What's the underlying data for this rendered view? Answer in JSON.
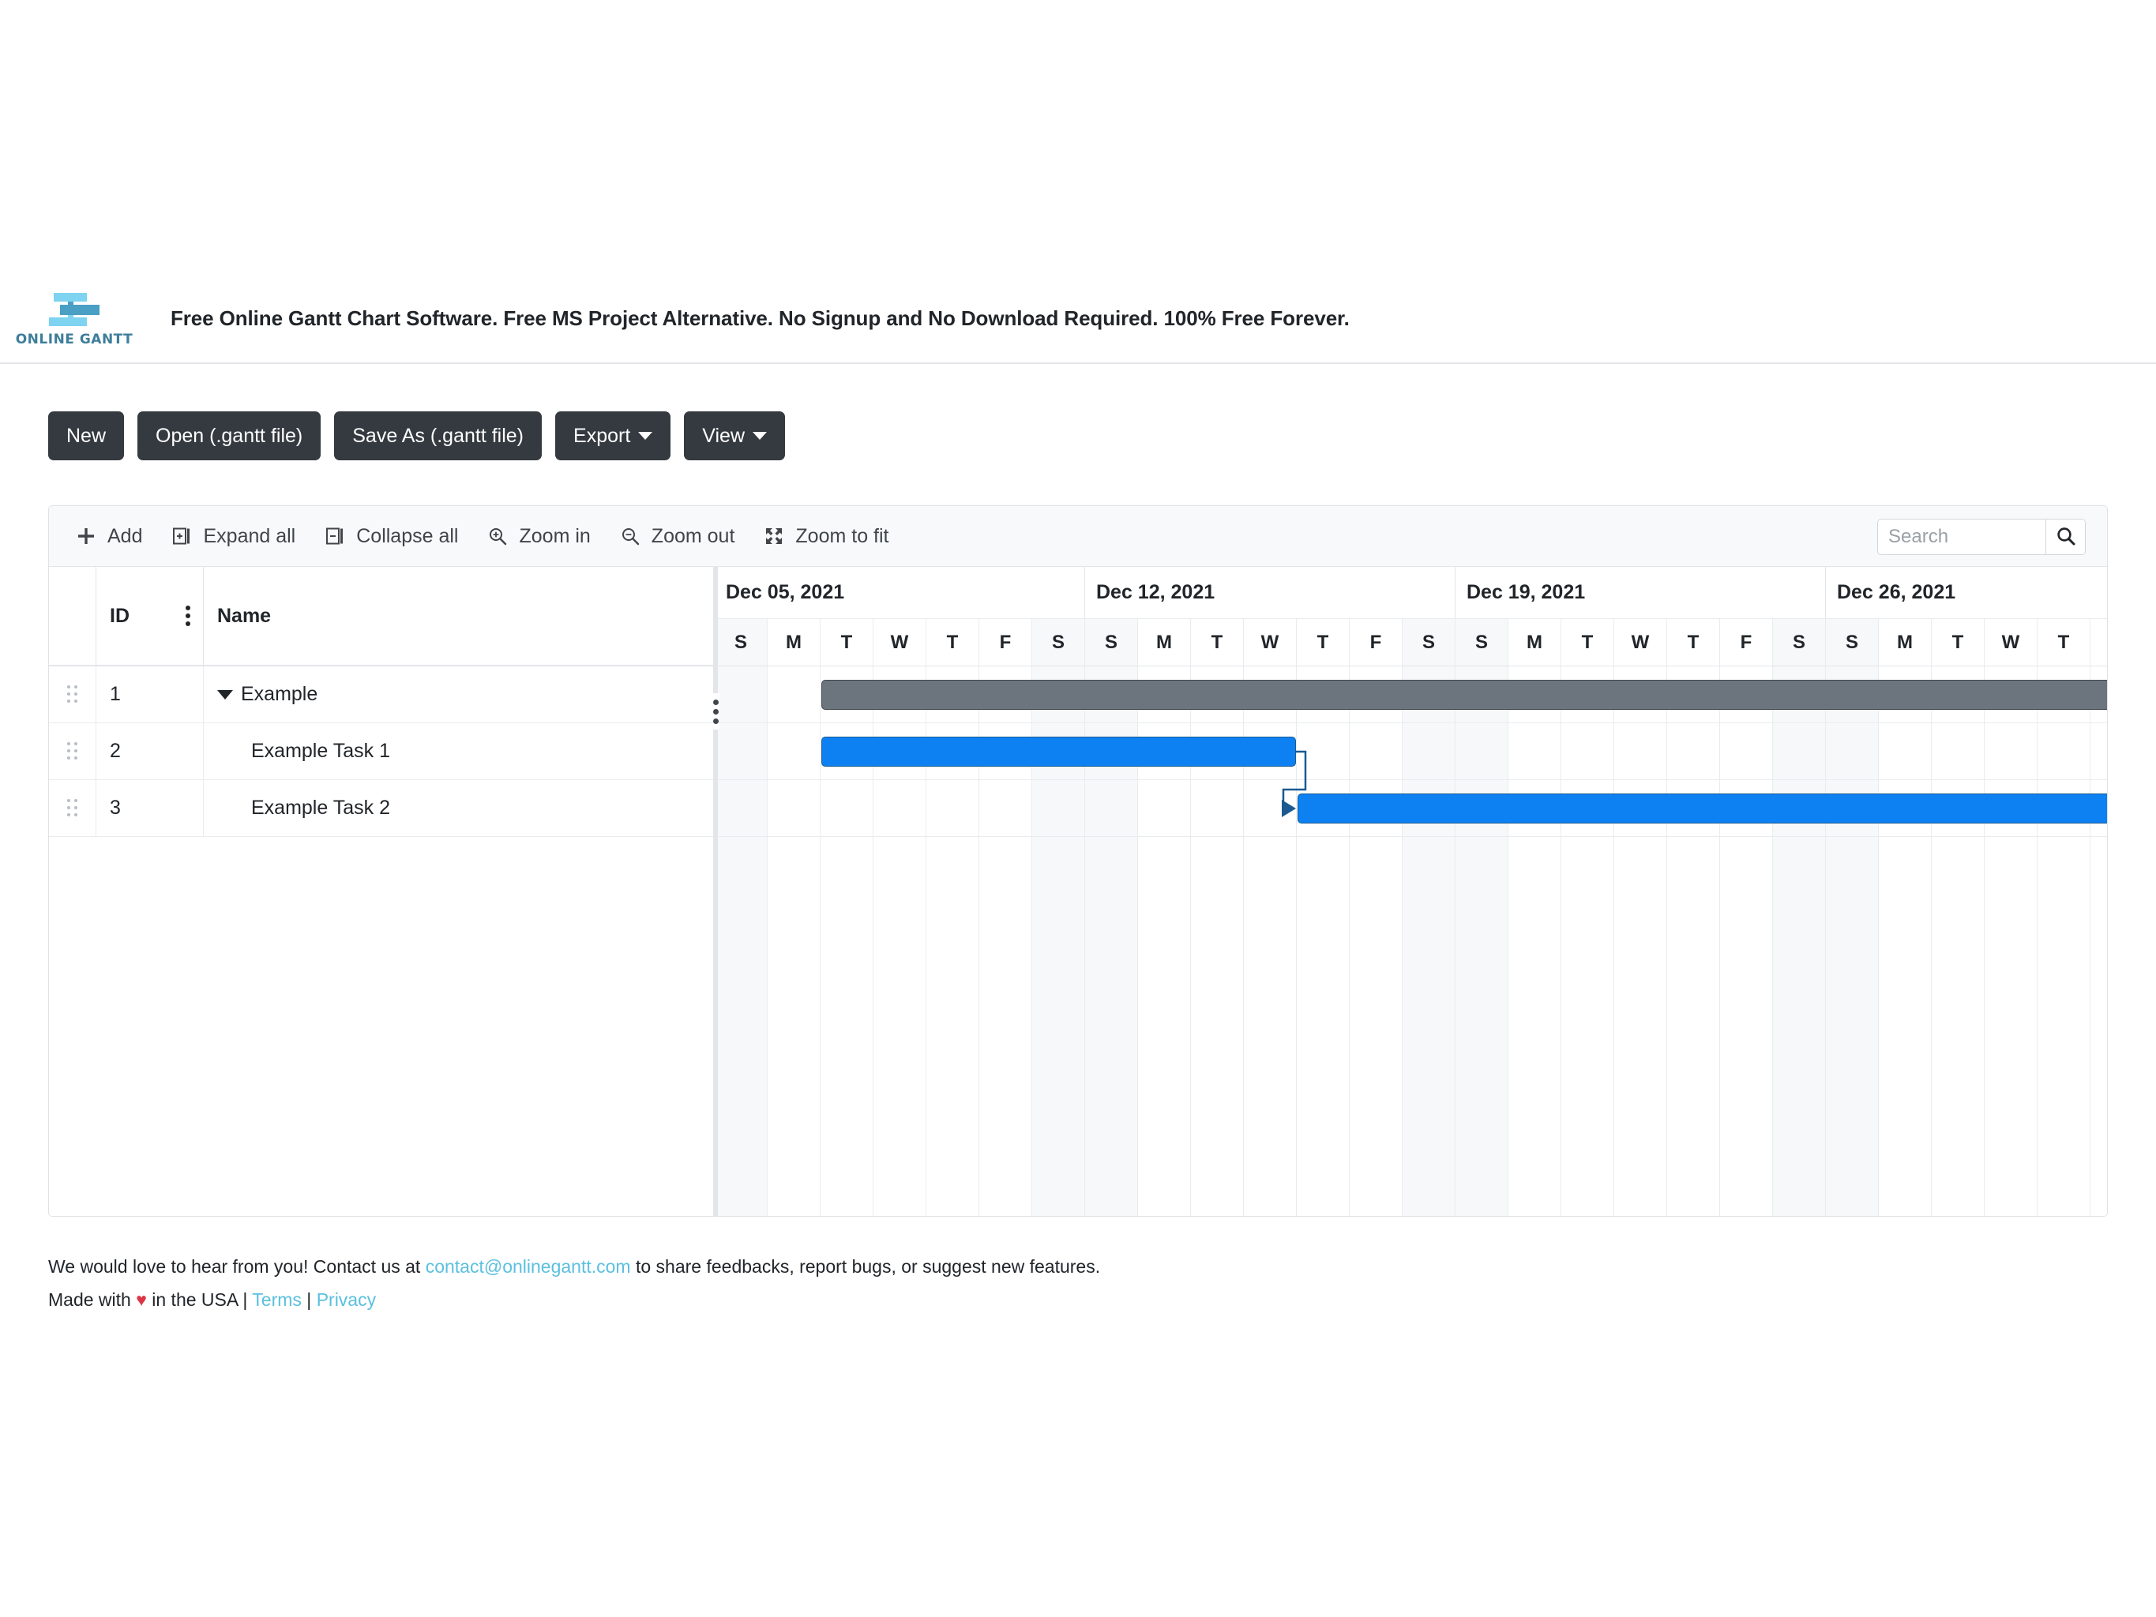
{
  "masthead": {
    "logo_word": "ONLINE GANTT",
    "logo_icon": "gantt-bars-logo",
    "tagline": "Free Online Gantt Chart Software. Free MS Project Alternative. No Signup and No Download Required. 100% Free Forever."
  },
  "file_toolbar": {
    "buttons": [
      {
        "label": "New",
        "caret": false
      },
      {
        "label": "Open (.gantt file)",
        "caret": false
      },
      {
        "label": "Save As (.gantt file)",
        "caret": false
      },
      {
        "label": "Export",
        "caret": true
      },
      {
        "label": "View",
        "caret": true
      }
    ]
  },
  "gantt_toolbar": {
    "actions": [
      {
        "label": "Add",
        "icon": "plus-icon"
      },
      {
        "label": "Expand all",
        "icon": "expand-all-icon"
      },
      {
        "label": "Collapse all",
        "icon": "collapse-all-icon"
      },
      {
        "label": "Zoom in",
        "icon": "zoom-in-icon"
      },
      {
        "label": "Zoom out",
        "icon": "zoom-out-icon"
      },
      {
        "label": "Zoom to fit",
        "icon": "zoom-to-fit-icon"
      }
    ],
    "search": {
      "placeholder": "Search",
      "value": "",
      "button_icon": "search-icon"
    }
  },
  "grid": {
    "columns": [
      {
        "key": "id",
        "label": "ID"
      },
      {
        "key": "name",
        "label": "Name"
      }
    ],
    "id_column_menu_icon": "kebab-menu-icon",
    "rows": [
      {
        "id": "1",
        "name": "Example",
        "type": "summary",
        "expanded": true,
        "indent": 0
      },
      {
        "id": "2",
        "name": "Example Task 1",
        "type": "task",
        "expanded": false,
        "indent": 1
      },
      {
        "id": "3",
        "name": "Example Task 2",
        "type": "task",
        "expanded": false,
        "indent": 1
      }
    ]
  },
  "chart_data": {
    "type": "bar",
    "title": "Gantt chart timeline",
    "weeks": [
      {
        "label": "Dec 05, 2021"
      },
      {
        "label": "Dec 12, 2021"
      },
      {
        "label": "Dec 19, 2021"
      },
      {
        "label": "Dec 26, 2021"
      }
    ],
    "day_labels": [
      "S",
      "M",
      "T",
      "W",
      "T",
      "F",
      "S"
    ],
    "weekend_indices": [
      0,
      6
    ],
    "day_column_width": 67,
    "total_days": 28,
    "bars": [
      {
        "row": 0,
        "task_id": "1",
        "name": "Example",
        "style": "summary",
        "color": "#6c757d",
        "border_color": "#41464b",
        "start_day_index": 2,
        "end_day_index": 27,
        "start_date": "Dec 07, 2021",
        "end_date": "Dec 31, 2021"
      },
      {
        "row": 1,
        "task_id": "2",
        "name": "Example Task 1",
        "style": "task",
        "color": "#0d80f2",
        "border_color": "#1a5a91",
        "start_day_index": 2,
        "end_day_index": 10,
        "start_date": "Dec 07, 2021",
        "end_date": "Dec 15, 2021"
      },
      {
        "row": 2,
        "task_id": "3",
        "name": "Example Task 2",
        "style": "task",
        "color": "#0d80f2",
        "border_color": "#1a5a91",
        "start_day_index": 11,
        "end_day_index": 27,
        "start_date": "Dec 16, 2021",
        "end_date": "Dec 31, 2021"
      }
    ],
    "dependencies": [
      {
        "from_task": "2",
        "to_task": "3",
        "type": "finish-to-start",
        "color": "#1a5a91"
      }
    ]
  },
  "footer": {
    "line1_before": "We would love to hear from you! Contact us at ",
    "email": "contact@onlinegantt.com",
    "line1_after": " to share feedbacks, report bugs, or suggest new features.",
    "line2_before": "Made with ",
    "heart": "♥",
    "line2_mid": " in the USA | ",
    "terms": "Terms",
    "line2_sep": " | ",
    "privacy": "Privacy"
  }
}
